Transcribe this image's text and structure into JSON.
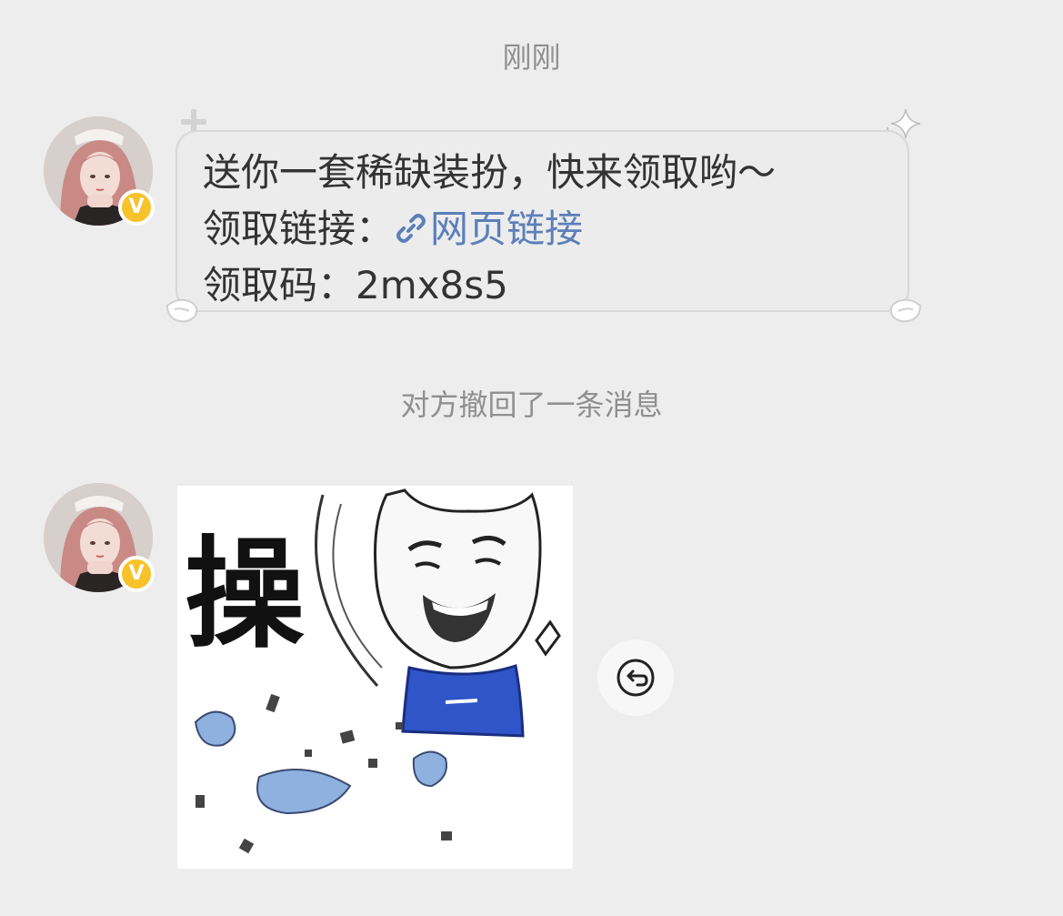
{
  "chat": {
    "timestamp": "刚刚",
    "system_notice": "对方撤回了一条消息",
    "messages": [
      {
        "type": "text",
        "avatar_icon": "avatar-photo",
        "verified_badge": "V",
        "lines": {
          "line1": "送你一套稀缺装扮，快来领取哟～",
          "line2_label": "领取链接：",
          "line2_link": "网页链接",
          "line3": "领取码：2mx8s5"
        }
      },
      {
        "type": "sticker",
        "avatar_icon": "avatar-photo",
        "verified_badge": "V",
        "sticker_text": "操"
      }
    ],
    "recall_button_icon": "undo-arrow-icon",
    "link_icon": "link-icon",
    "colors": {
      "background": "#ededed",
      "link": "#5b7fb9",
      "badge": "#f7c22a",
      "muted_text": "#8f8f8f"
    }
  }
}
